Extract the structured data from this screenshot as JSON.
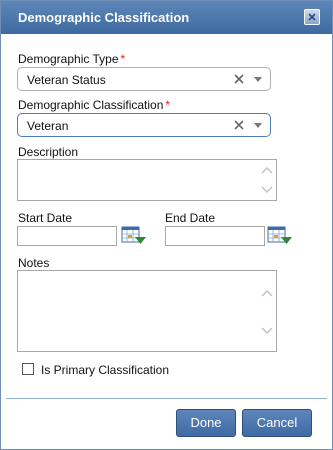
{
  "dialog": {
    "title": "Demographic Classification"
  },
  "form": {
    "demographic_type": {
      "label": "Demographic Type",
      "required_mark": "*",
      "value": "Veteran Status"
    },
    "demographic_classification": {
      "label": "Demographic Classification",
      "required_mark": "*",
      "value": "Veteran"
    },
    "description": {
      "label": "Description",
      "value": ""
    },
    "start_date": {
      "label": "Start Date",
      "value": ""
    },
    "end_date": {
      "label": "End Date",
      "value": ""
    },
    "notes": {
      "label": "Notes",
      "value": ""
    },
    "is_primary": {
      "label": "Is Primary Classification",
      "checked": false
    }
  },
  "buttons": {
    "done": "Done",
    "cancel": "Cancel"
  },
  "icons": {
    "close": "close-icon",
    "clear": "clear-x-icon",
    "dropdown": "chevron-down-icon",
    "calendar": "calendar-icon",
    "scroll_up": "scroll-up-icon",
    "scroll_down": "scroll-down-icon"
  },
  "colors": {
    "titlebar": "#4a76ad",
    "button": "#4f78b0",
    "required": "#d8222a"
  }
}
